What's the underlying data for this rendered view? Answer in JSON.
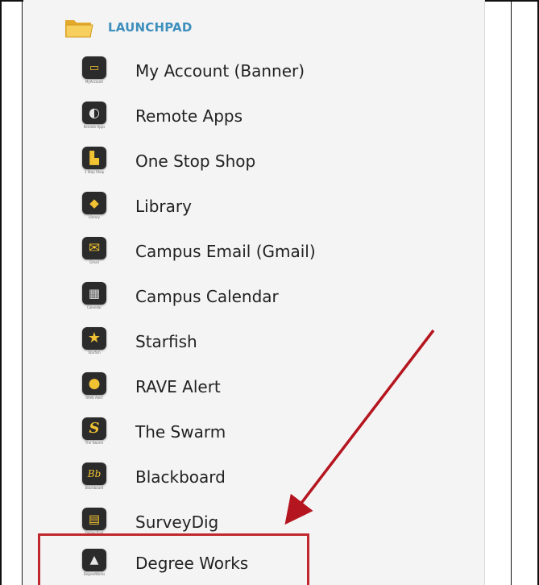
{
  "header": {
    "label": "LAUNCHPAD",
    "icon": "folder-icon"
  },
  "items": [
    {
      "name": "my-account-banner",
      "label": "My Account (Banner)",
      "icon": "account-card-icon",
      "caption": "MyAccount"
    },
    {
      "name": "remote-apps",
      "label": "Remote Apps",
      "icon": "remote-apps-icon",
      "caption": "Remote Apps"
    },
    {
      "name": "one-stop-shop",
      "label": "One Stop Shop",
      "icon": "cart-icon",
      "caption": "1 Stop Shop"
    },
    {
      "name": "library",
      "label": "Library",
      "icon": "book-icon",
      "caption": "Library"
    },
    {
      "name": "campus-email-gmail",
      "label": "Campus Email (Gmail)",
      "icon": "envelope-icon",
      "caption": "Gmail"
    },
    {
      "name": "campus-calendar",
      "label": "Campus Calendar",
      "icon": "calendar-icon",
      "caption": "Calendar"
    },
    {
      "name": "starfish",
      "label": "Starfish",
      "icon": "starfish-icon",
      "caption": "Starfish"
    },
    {
      "name": "rave-alert",
      "label": "RAVE Alert",
      "icon": "alert-icon",
      "caption": "RAVE Alert"
    },
    {
      "name": "the-swarm",
      "label": "The Swarm",
      "icon": "swarm-icon",
      "caption": "The Swarm"
    },
    {
      "name": "blackboard",
      "label": "Blackboard",
      "icon": "blackboard-icon",
      "caption": "Blackboard"
    },
    {
      "name": "surveydig",
      "label": "SurveyDig",
      "icon": "survey-icon",
      "caption": "Online Eval"
    },
    {
      "name": "degree-works",
      "label": "Degree Works",
      "icon": "graduation-cap-icon",
      "caption": "DegreeWorks"
    }
  ],
  "colors": {
    "header": "#3d8fbd",
    "highlight": "#c0282e",
    "icon_accent": "#f1c232"
  }
}
